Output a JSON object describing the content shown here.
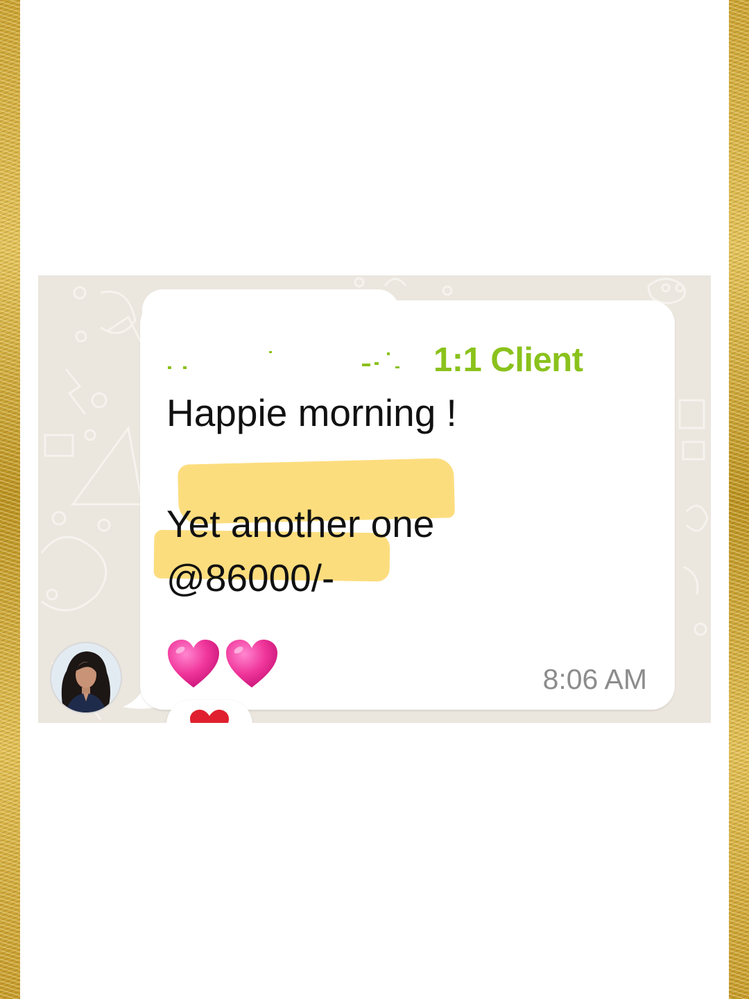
{
  "message": {
    "sender_tag": "1:1 Client",
    "greeting": "Happie morning !",
    "line_2": "Yet another one",
    "line_3": "@86000/-",
    "timestamp": "8:06 AM"
  },
  "icons": {
    "heart_emoji": "pink-heart-emoji",
    "reaction": "red-heart-reaction"
  },
  "colors": {
    "sender_tag": "#8ac21c",
    "highlight": "#fbd662",
    "chat_background": "#ebe6de",
    "border_gold": "#c9a232",
    "heart_pink": "#f0369b",
    "reaction_red": "#e0202e"
  }
}
